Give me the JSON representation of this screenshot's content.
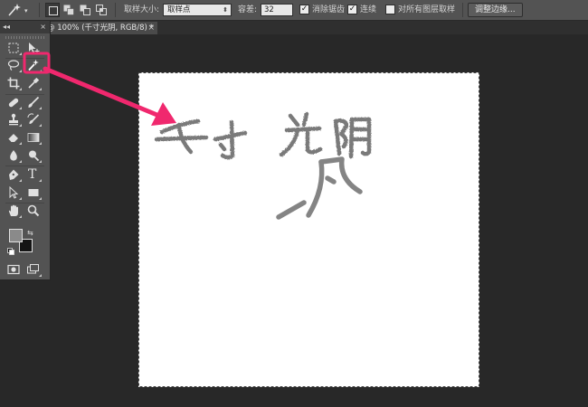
{
  "options_bar": {
    "tool_preset_icon": "magic-wand-icon",
    "selection_modes": [
      {
        "icon": "new-selection-icon",
        "active": true
      },
      {
        "icon": "add-to-selection-icon",
        "active": false
      },
      {
        "icon": "subtract-from-selection-icon",
        "active": false
      },
      {
        "icon": "intersect-selection-icon",
        "active": false
      }
    ],
    "sample_size_label": "取样大小:",
    "sample_size_value": "取样点",
    "tolerance_label": "容差:",
    "tolerance_value": "32",
    "anti_alias": {
      "label": "消除锯齿",
      "checked": true
    },
    "contiguous": {
      "label": "连续",
      "checked": true
    },
    "sample_all_layers": {
      "label": "对所有图层取样",
      "checked": false
    },
    "refine_edge_label": "调整边缘..."
  },
  "document_tab": {
    "title": "@ 100% (千寸光阴, RGB/8) *",
    "close_glyph": "×"
  },
  "tools_panel": {
    "header_collapse_glyph": "◂◂",
    "header_close_glyph": "×",
    "swap_glyph": "⇆",
    "foreground_color": "#8a8a8a",
    "background_color": "#151515",
    "tools": [
      "rectangular-marquee-icon",
      "move-icon",
      "lasso-icon",
      "magic-wand-icon",
      "crop-icon",
      "eyedropper-icon",
      "spot-healing-icon",
      "brush-icon",
      "clone-stamp-icon",
      "history-brush-icon",
      "eraser-icon",
      "gradient-icon",
      "blur-icon",
      "dodge-icon",
      "pen-icon",
      "type-icon",
      "path-selection-icon",
      "rectangle-shape-icon",
      "hand-icon",
      "zoom-icon",
      "quick-mask-icon",
      "screen-mode-icon"
    ],
    "type_tool_glyph": "T"
  },
  "annotation": {
    "highlight_color": "#f0286e",
    "arrow_color": "#f0286e"
  }
}
